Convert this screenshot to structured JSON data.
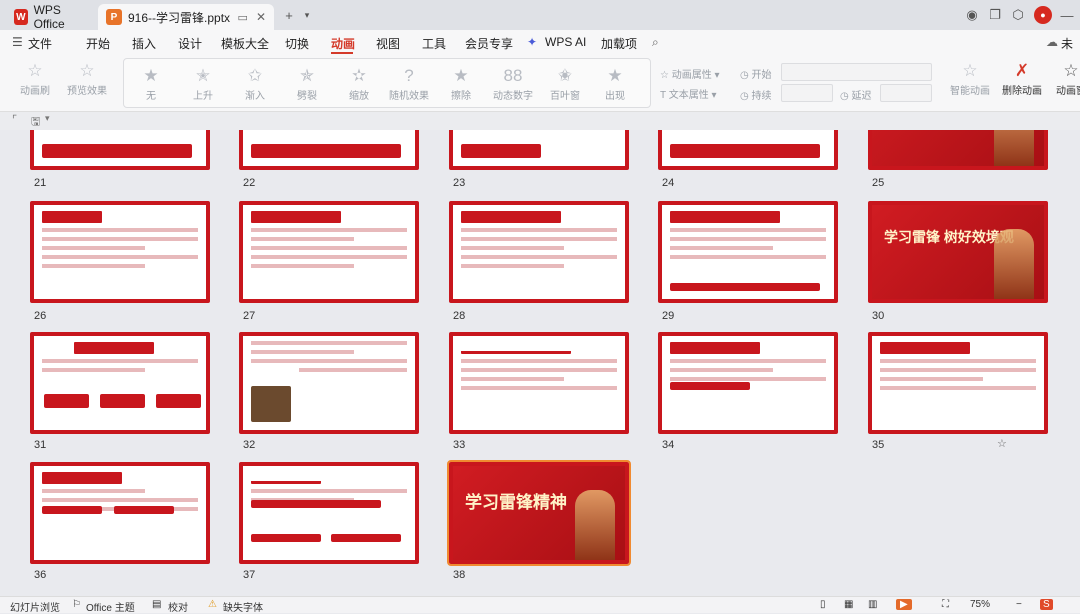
{
  "titlebar": {
    "app_tab": "WPS Office",
    "doc_tab": "916--学习雷锋.pptx"
  },
  "menu": [
    "文件",
    "开始",
    "插入",
    "设计",
    "模板大全",
    "切换",
    "动画",
    "视图",
    "工具",
    "会员专享",
    "WPS AI",
    "加载项"
  ],
  "menu_right": "未上",
  "ribbon": {
    "left": [
      "动画刷",
      "预览效果"
    ],
    "gallery": [
      "无",
      "上升",
      "渐入",
      "劈裂",
      "缩放",
      "随机效果",
      "擦除",
      "动态数字",
      "百叶窗",
      "出现"
    ],
    "property": [
      "动画属性",
      "文本属性"
    ],
    "timing": [
      "开始",
      "持续",
      "延迟"
    ],
    "right": [
      "智能动画",
      "删除动画",
      "动画窗"
    ]
  },
  "slides": [
    {
      "n": "21"
    },
    {
      "n": "22"
    },
    {
      "n": "23"
    },
    {
      "n": "24"
    },
    {
      "n": "25"
    },
    {
      "n": "26"
    },
    {
      "n": "27"
    },
    {
      "n": "28"
    },
    {
      "n": "29"
    },
    {
      "n": "30",
      "title": "学习雷锋 树好效境观"
    },
    {
      "n": "31"
    },
    {
      "n": "32"
    },
    {
      "n": "33"
    },
    {
      "n": "34"
    },
    {
      "n": "35"
    },
    {
      "n": "36"
    },
    {
      "n": "37"
    },
    {
      "n": "38",
      "title": "学习雷锋精神"
    }
  ],
  "status": {
    "slide_browse": "幻灯片浏览",
    "theme": "Office 主题",
    "proof": "校对",
    "missing_font": "缺失字体",
    "zoom": "75%"
  },
  "colors": {
    "accent": "#d43a2a",
    "slide_red": "#c8161d"
  }
}
